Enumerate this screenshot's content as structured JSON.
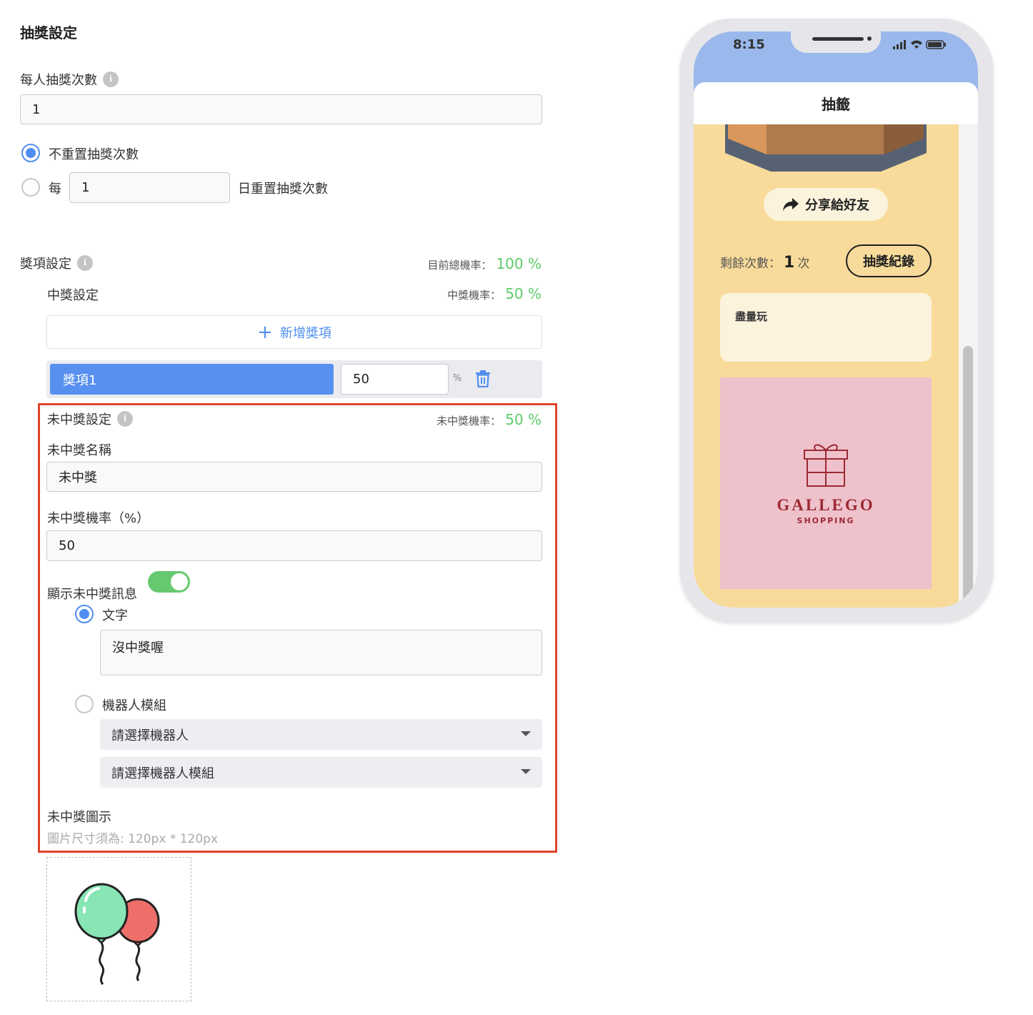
{
  "draw_settings": {
    "title": "抽獎設定",
    "per_person_label": "每人抽獎次數",
    "per_person_value": "1",
    "reset_option_none": "不重置抽獎次數",
    "reset_every_prefix": "每",
    "reset_every_value": "1",
    "reset_every_suffix": "日重置抽獎次數"
  },
  "prize_settings": {
    "title": "獎項設定",
    "total_rate_label": "目前總機率：",
    "total_rate_value": "100 %",
    "win_title": "中獎設定",
    "win_rate_label": "中獎機率：",
    "win_rate_value": "50 %",
    "add_prize_label": "新增獎項",
    "prizes": [
      {
        "name": "獎項1",
        "rate": "50",
        "unit": "%"
      }
    ]
  },
  "no_win": {
    "title": "未中獎設定",
    "rate_label": "未中獎機率：",
    "rate_value": "50 %",
    "name_label": "未中獎名稱",
    "name_value": "未中獎",
    "prob_label": "未中獎機率（%）",
    "prob_value": "50",
    "show_msg_label": "顯示未中獎訊息",
    "show_msg_on": true,
    "option_text": "文字",
    "text_value": "沒中獎喔",
    "option_bot": "機器人模組",
    "select_bot_placeholder": "請選擇機器人",
    "select_module_placeholder": "請選擇機器人模組",
    "icon_label": "未中獎圖示",
    "icon_hint": "圖片尺寸須為: 120px * 120px"
  },
  "phone": {
    "time": "8:15",
    "header_title": "抽籤",
    "share_label": "分享給好友",
    "remaining_label": "剩餘次數：",
    "remaining_count": "1",
    "remaining_unit": "次",
    "record_button": "抽獎紀錄",
    "message": "盡量玩",
    "brand_name": "GALLEGO",
    "brand_sub": "SHOPPING"
  },
  "colors": {
    "accent_blue": "#4f8ef0",
    "green": "#5ecb6b",
    "highlight_red": "#e0432b",
    "phone_bg": "#f8db9a",
    "phone_header": "#9ab8ec",
    "banner_pink": "#eec1cb"
  }
}
